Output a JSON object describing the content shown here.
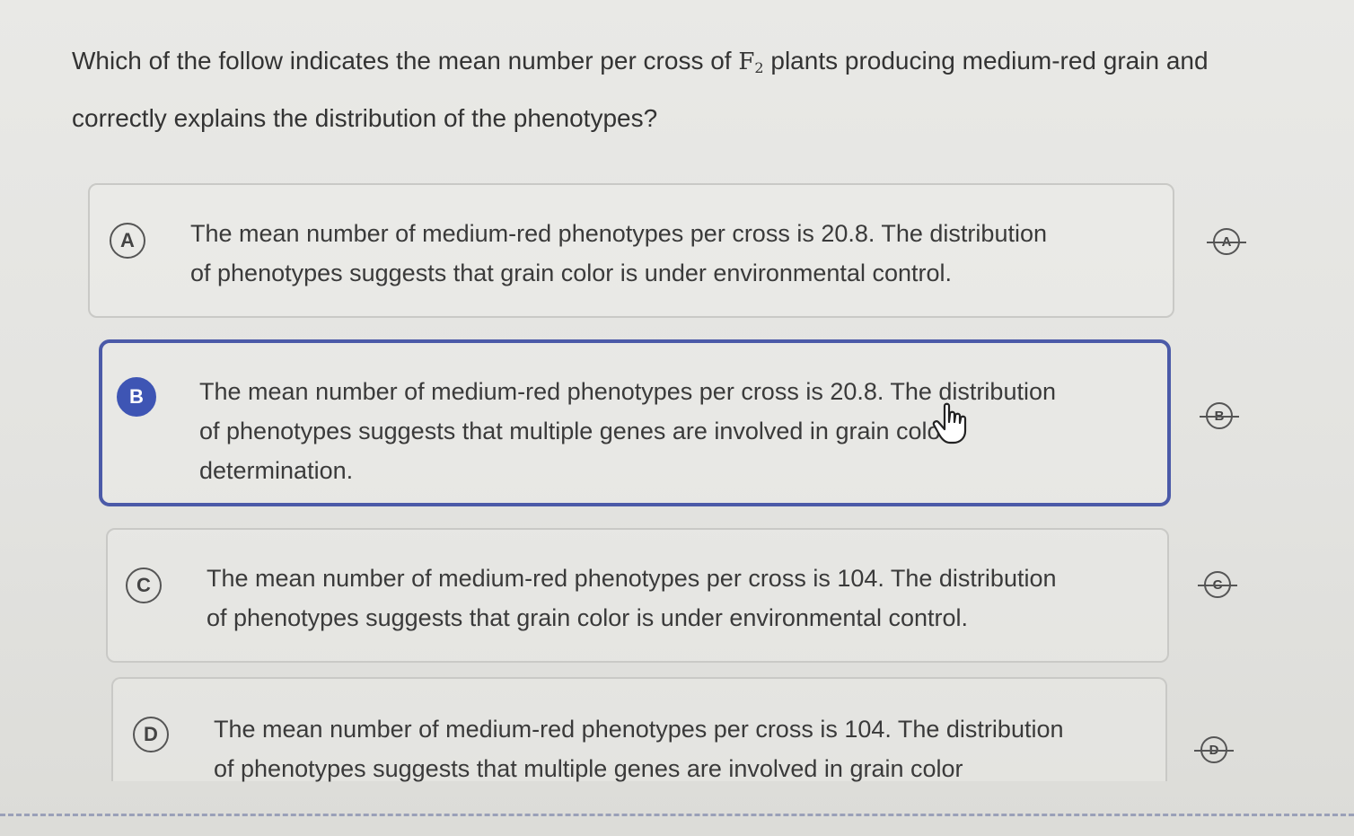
{
  "question": {
    "line1_before": "Which of the follow indicates the mean number per cross of",
    "generation_symbol": "F",
    "generation_subscript": "2",
    "line1_after": "plants producing medium-red grain and",
    "line2": "correctly explains the distribution of the phenotypes?"
  },
  "options": [
    {
      "letter": "A",
      "line1": "The mean number of medium-red phenotypes per cross is 20.8. The distribution",
      "line2": "of phenotypes suggests that grain color is under environmental control.",
      "strike_letter": "A"
    },
    {
      "letter": "B",
      "line1": "The mean number of medium-red phenotypes per cross is 20.8. The distribution",
      "line2": "of phenotypes suggests that multiple genes are involved in grain color",
      "line3": "determination.",
      "strike_letter": "B",
      "selected": true
    },
    {
      "letter": "C",
      "line1": "The mean number of medium-red phenotypes per cross is 104. The distribution",
      "line2": "of phenotypes suggests that grain color is under environmental control.",
      "strike_letter": "C"
    },
    {
      "letter": "D",
      "line1": "The mean number of medium-red phenotypes per cross is 104. The distribution",
      "line2": "of phenotypes suggests that multiple genes are involved in grain color",
      "strike_letter": "D"
    }
  ],
  "colors": {
    "selected_accent": "#3e55b4",
    "selected_border": "#4b5aa8",
    "option_border": "#c9c9c6"
  },
  "icons": {
    "cursor": "hand-pointer-icon",
    "strikethrough": "eliminate-answer-icon"
  }
}
